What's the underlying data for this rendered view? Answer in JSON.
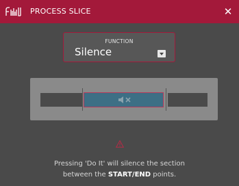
{
  "header": {
    "title": "PROCESS SLICE",
    "close_symbol": "✕",
    "logo_icon": "akai-logo-icon"
  },
  "function_selector": {
    "label": "FUNCTION",
    "value": "Silence",
    "icon": "dropdown-icon"
  },
  "waveform": {
    "selection_icon": "mute-icon"
  },
  "info": {
    "icon": "warning-icon",
    "line1": "Pressing 'Do It' will silence the section",
    "line2_before": "between the ",
    "line2_bold": "START/END",
    "line2_after": " points."
  },
  "colors": {
    "accent": "#a3193a",
    "background": "#4a4a4a",
    "selection": "#3d6f85"
  }
}
